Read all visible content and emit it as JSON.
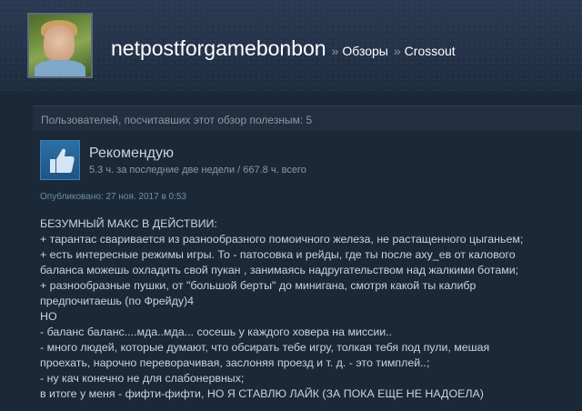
{
  "header": {
    "username": "netpostforgamebonbon",
    "separator": "»",
    "breadcrumbs": [
      "Обзоры",
      "Crossout"
    ]
  },
  "review": {
    "helpful_text": "Пользователей, посчитавших этот обзор полезным: 5",
    "recommendation": "Рекомендую",
    "hours": "5.3 ч. за последние две недели / 667.8 ч. всего",
    "posted": "Опубликовано: 27 ноя. 2017 в 0:53",
    "text_lines": [
      "БЕЗУМНЫЙ МАКС В ДЕЙСТВИИ:",
      "+ тарантас сваривается из разнообразного помоичного железа, не растащенного цыганьем;",
      "+ есть интересные режимы игры. То - патосовка и рейды, где ты после аху_ев от калового",
      "баланса можешь охладить свой пукан , занимаясь надругательством над жалкими ботами;",
      "+ разнообразные пушки, от \"большой берты\" до минигана, смотря какой ты калибр",
      "предпочитаешь (по Фрейду)4",
      "НО",
      "- баланс баланс....мда..мда... сосешь у каждого ховера на миссии..",
      "- много людей, которые думают, что обсирать тебе игру, толкая тебя под пули, мешая",
      "проехать, нарочно переворачивая, заслоняя проезд и т. д. - это тимплей..;",
      "- ну кач конечно не для слабонервных;",
      "в итоге у меня - фифти-фифти, НО Я СТАВЛЮ ЛАЙК (ЗА ПОКА ЕЩЕ НЕ НАДОЕЛА)"
    ]
  },
  "icons": {
    "recommend": "thumbs-up-icon"
  },
  "colors": {
    "background": "#1b2838",
    "text": "#c6d4df",
    "muted": "#8f98a0",
    "thumb_blue": "#2d6fa5"
  }
}
